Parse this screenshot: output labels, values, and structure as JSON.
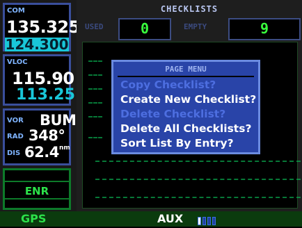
{
  "com": {
    "label": "COM",
    "active": "135.325",
    "standby": "124.300"
  },
  "vloc": {
    "label": "VLOC",
    "active": "115.90",
    "standby": "113.25"
  },
  "vor": {
    "label": "VOR",
    "ident": "BUM",
    "rad_label": "RAD",
    "radial": "348°",
    "dis_label": "DIS",
    "distance": "62.4",
    "unit": "nm"
  },
  "mode": "ENR",
  "header": {
    "title": "CHECKLISTS",
    "used_label": "USED",
    "used_value": "0",
    "empty_label": "EMPTY",
    "empty_value": "9"
  },
  "menu": {
    "title": "PAGE MENU",
    "items": [
      {
        "label": "Copy Checklist?",
        "enabled": false
      },
      {
        "label": "Create New Checklist?",
        "enabled": true
      },
      {
        "label": "Delete Checklist?",
        "enabled": false
      },
      {
        "label": "Delete All Checklists?",
        "enabled": true
      },
      {
        "label": "Sort List By Entry?",
        "enabled": true
      }
    ]
  },
  "status": {
    "left": "GPS",
    "page_group": "AUX",
    "page_count": 4,
    "current_page": 1
  },
  "colors": {
    "accent_cyan": "#19c7d9",
    "menu_bg": "#2944a8",
    "value_green": "#39ff3d",
    "status_bg": "#0b3b0e"
  }
}
